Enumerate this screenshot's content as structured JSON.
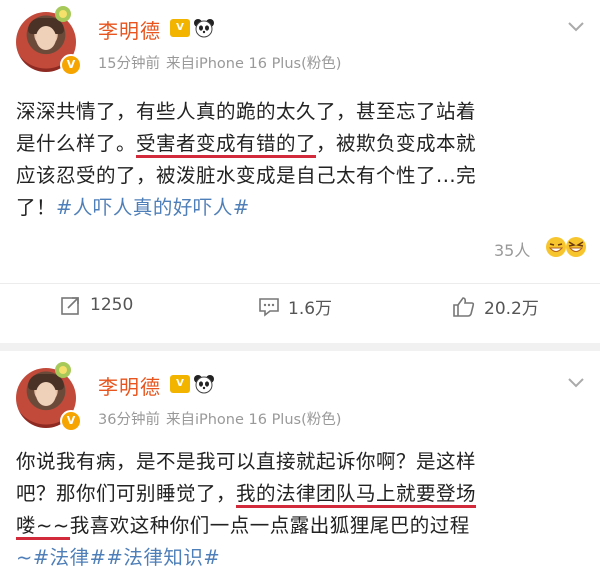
{
  "posts": [
    {
      "username": "李明德",
      "time": "15分钟前",
      "source": "来自iPhone 16 Plus(粉色)",
      "content": {
        "l1": "深深共情了，有些人真的跪的太久了，甚至忘了站着",
        "l2a": "是什么样了。",
        "l2b": "受害者变成有错的了",
        "l2c": "，被欺负变成本就",
        "l3": "应该忍受的了，被泼脏水变成是自己太有个性了...完",
        "l4a": "了！",
        "l4b": "#人吓人真的好吓人#"
      },
      "likes_reaction": "35人",
      "actions": {
        "repost": "1250",
        "comment": "1.6万",
        "like": "20.2万"
      }
    },
    {
      "username": "李明德",
      "time": "36分钟前",
      "source": "来自iPhone 16 Plus(粉色)",
      "content": {
        "l1": "你说我有病，是不是我可以直接就起诉你啊？是这样",
        "l2a": "吧？那你们可别睡觉了，",
        "l2b": "我的法律团队马上就要登场",
        "l3a": "喽~~",
        "l3b": "我喜欢这种你们一点一点露出狐狸尾巴的过程",
        "l4": "~#法律##法律知识#"
      }
    }
  ],
  "colors": {
    "username": "#e8551e",
    "tag": "#4f7fb8",
    "underline": "#d22a3a",
    "meta": "#999999"
  },
  "icons": [
    "avatar",
    "verified-badge",
    "vip-icon",
    "panda-icon",
    "chevron-down-icon",
    "repost-icon",
    "comment-icon",
    "like-icon",
    "laugh-emoji-icon"
  ]
}
